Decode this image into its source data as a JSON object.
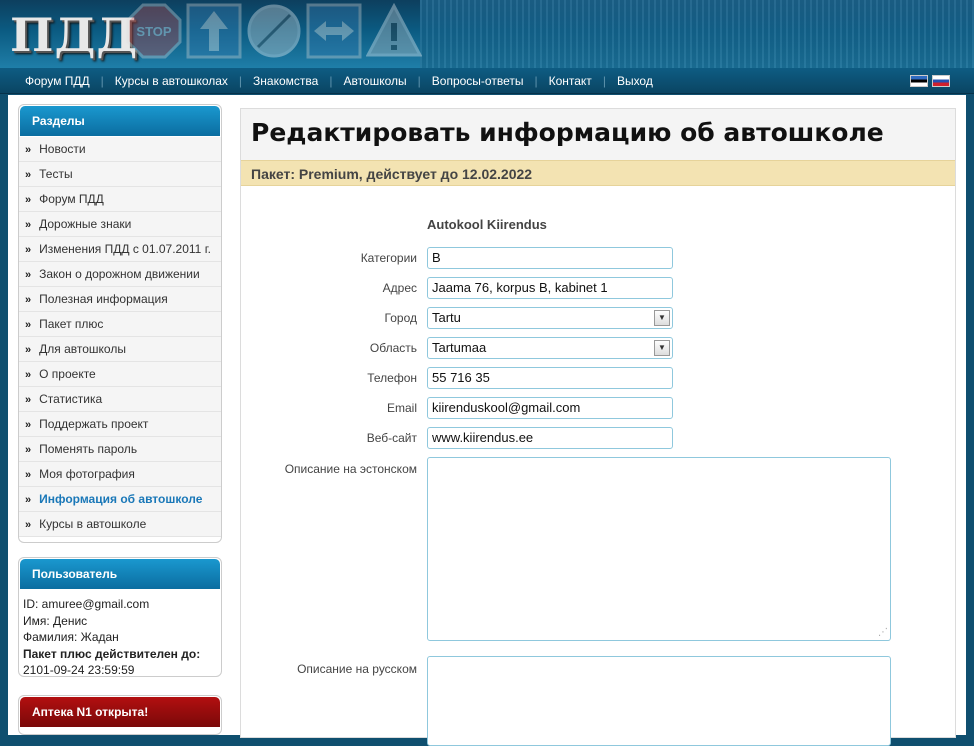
{
  "header": {
    "logo": "ПДД",
    "signs": [
      "stop-sign-icon",
      "arrow-up-sign-icon",
      "end-restriction-sign-icon",
      "two-way-arrow-sign-icon",
      "warning-sign-icon"
    ],
    "stop_text": "STOP"
  },
  "nav": {
    "items": [
      "Форум ПДД",
      "Курсы в автошколах",
      "Знакомства",
      "Автошколы",
      "Вопросы-ответы",
      "Контакт",
      "Выход"
    ]
  },
  "sidebar": {
    "sections_title": "Разделы",
    "items": [
      {
        "label": "Новости"
      },
      {
        "label": "Тесты"
      },
      {
        "label": "Форум ПДД"
      },
      {
        "label": "Дорожные знаки"
      },
      {
        "label": "Изменения ПДД с 01.07.2011 г."
      },
      {
        "label": "Закон о дорожном движении"
      },
      {
        "label": "Полезная информация"
      },
      {
        "label": "Пакет плюс"
      },
      {
        "label": "Для автошколы"
      },
      {
        "label": "О проекте"
      },
      {
        "label": "Статистика"
      },
      {
        "label": "Поддержать проект"
      },
      {
        "label": "Поменять пароль"
      },
      {
        "label": "Моя фотография"
      },
      {
        "label": "Информация об автошколе",
        "active": true
      },
      {
        "label": "Курсы в автошколе"
      }
    ],
    "user": {
      "title": "Пользователь",
      "id_line": "ID: amuree@gmail.com",
      "name_line": "Имя: Денис",
      "surname_line": "Фамилия: Жадан",
      "plus_label": "Пакет плюс действителен до:",
      "plus_date": "2101-09-24 23:59:59"
    },
    "pharmacy_title": "Аптека N1 открыта!"
  },
  "main": {
    "title": "Редактировать информацию об автошколе",
    "package": "Пакет: Premium, действует до 12.02.2022",
    "school_name": "Autokool Kiirendus",
    "fields": [
      {
        "label": "Категории",
        "value": "B",
        "type": "text"
      },
      {
        "label": "Адрес",
        "value": "Jaama 76, korpus B, kabinet 1",
        "type": "text"
      },
      {
        "label": "Город",
        "value": "Tartu",
        "type": "select"
      },
      {
        "label": "Область",
        "value": "Tartumaa",
        "type": "select"
      },
      {
        "label": "Телефон",
        "value": "55 716 35",
        "type": "text"
      },
      {
        "label": "Email",
        "value": "kiirenduskool@gmail.com",
        "type": "text"
      },
      {
        "label": "Веб-сайт",
        "value": "www.kiirendus.ee",
        "type": "text"
      }
    ],
    "desc_et_label": "Описание на эстонском",
    "desc_ru_label": "Описание на русском"
  },
  "colors": {
    "header_bg": "#0b5b82",
    "accent": "#1a98cf",
    "active_link": "#1a78b8",
    "package_bg": "#f3e3b2",
    "pharmacy_bg": "#b20f10"
  }
}
